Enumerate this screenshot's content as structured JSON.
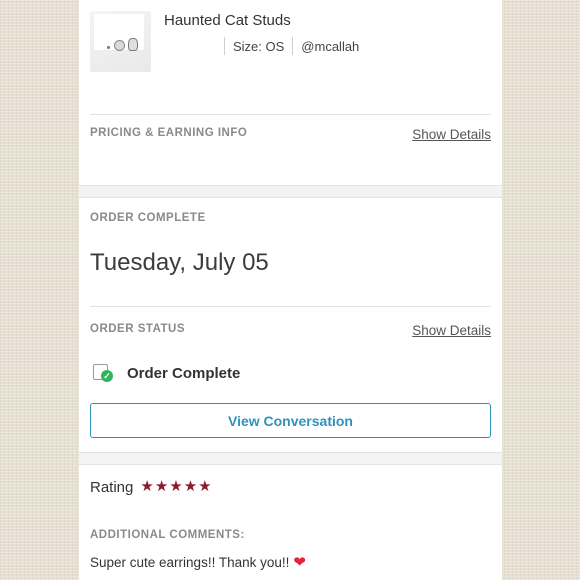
{
  "product": {
    "title": "Haunted Cat Studs",
    "size": "Size: OS",
    "seller": "@mcallah"
  },
  "pricing": {
    "label": "PRICING & EARNING INFO",
    "action": "Show Details"
  },
  "order_complete": {
    "label": "ORDER COMPLETE",
    "date": "Tuesday, July 05"
  },
  "order_status": {
    "label": "ORDER STATUS",
    "action": "Show Details",
    "status": "Order Complete",
    "status_color": "#2fb45a",
    "button": "View Conversation",
    "button_color": "#2e93b8"
  },
  "rating": {
    "label": "Rating",
    "stars": 5,
    "star_color": "#8c1c2c"
  },
  "comments": {
    "label": "ADDITIONAL COMMENTS:",
    "text": "Super cute earrings!! Thank you!!",
    "emoji": "heart-emoji"
  }
}
